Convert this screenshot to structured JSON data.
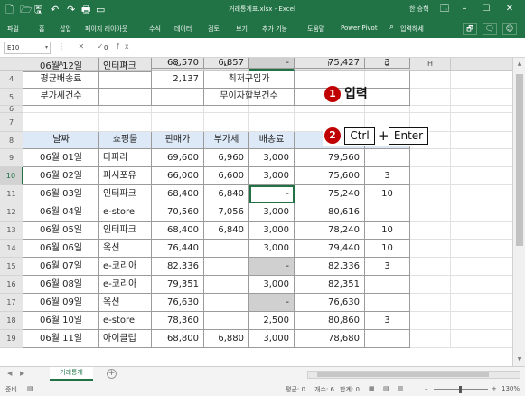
{
  "window": {
    "title": "거래통계표.xlsx - Excel",
    "user": "한 승혁",
    "quick_access": [
      "🗋",
      "🗁",
      "🖫",
      "↶",
      "↷",
      "🖶",
      "▭"
    ],
    "controls": [
      "🗔",
      "–",
      "☐",
      "✕"
    ]
  },
  "ribbon": {
    "tabs": [
      "파일",
      "홈",
      "삽입",
      "페이지 레이아웃",
      "수식",
      "데이터",
      "검토",
      "보기",
      "추가 기능",
      "도움말",
      "Power Pivot"
    ],
    "search_placeholder": "입력하세",
    "share_icons": [
      "🗗",
      "🗨",
      "☺"
    ]
  },
  "formula_bar": {
    "name_box": "E10",
    "icons": "⋮ ✕ ✓ fx",
    "value": "0"
  },
  "columns": [
    "A",
    "B",
    "C",
    "D",
    "E",
    "F",
    "G",
    "H",
    "I"
  ],
  "rows_visible": [
    "4",
    "5",
    "6",
    "7",
    "8",
    "9",
    "10",
    "11",
    "12",
    "13",
    "14",
    "15",
    "16",
    "17",
    "18",
    "19"
  ],
  "summary": {
    "avg_shipping_label": "평균배송료",
    "avg_shipping_value": "2,137",
    "min_purchase_label": "최저구입가",
    "vat_count_label": "부가세건수",
    "free_shipping_label": "무이자할부건수"
  },
  "table": {
    "headers": [
      "날짜",
      "쇼핑몰",
      "판매가",
      "부가세",
      "배송료",
      ""
    ],
    "rows": [
      [
        "06월 01일",
        "다파라",
        "69,600",
        "6,960",
        "3,000",
        "79,560",
        ""
      ],
      [
        "06월 02일",
        "피시포유",
        "66,000",
        "6,600",
        "3,000",
        "75,600",
        "3"
      ],
      [
        "06월 03일",
        "인터파크",
        "68,400",
        "6,840",
        "-",
        "75,240",
        "10"
      ],
      [
        "06월 04일",
        "e-store",
        "70,560",
        "7,056",
        "3,000",
        "80,616",
        ""
      ],
      [
        "06월 05일",
        "인터파크",
        "68,400",
        "6,840",
        "3,000",
        "78,240",
        "10"
      ],
      [
        "06월 06일",
        "옥션",
        "76,440",
        "",
        "3,000",
        "79,440",
        "10"
      ],
      [
        "06월 07일",
        "e-코리아",
        "82,336",
        "",
        "-",
        "82,336",
        "3"
      ],
      [
        "06월 08일",
        "e-코리아",
        "79,351",
        "",
        "3,000",
        "82,351",
        ""
      ],
      [
        "06월 09일",
        "옥션",
        "76,630",
        "",
        "-",
        "76,630",
        ""
      ],
      [
        "06월 10일",
        "e-store",
        "78,360",
        "",
        "2,500",
        "80,860",
        "3"
      ],
      [
        "06월 11일",
        "아이클럽",
        "68,800",
        "6,880",
        "3,000",
        "78,680",
        ""
      ],
      [
        "06월 12일",
        "인터파크",
        "68,570",
        "6,857",
        "-",
        "75,427",
        "3"
      ]
    ]
  },
  "callouts": {
    "step1_number": "1",
    "step1_text": "입력",
    "step2_number": "2",
    "step2_key1": "Ctrl",
    "step2_plus": "+",
    "step2_key2": "Enter"
  },
  "sheet_tabs": {
    "nav_prev": "◀",
    "nav_next": "▶",
    "active": "거래통계",
    "add": "+"
  },
  "status": {
    "ready": "준비",
    "macro_icon": "▤",
    "average": "평균: 0",
    "count": "개수: 6",
    "sum": "합계: 0",
    "zoom_minus": "–",
    "zoom_plus": "+",
    "zoom": "130%"
  },
  "colors": {
    "excel_green": "#217346",
    "header_fill": "#dde9f7",
    "gray_fill": "#d0d0d0",
    "step_badge": "#c00000"
  }
}
